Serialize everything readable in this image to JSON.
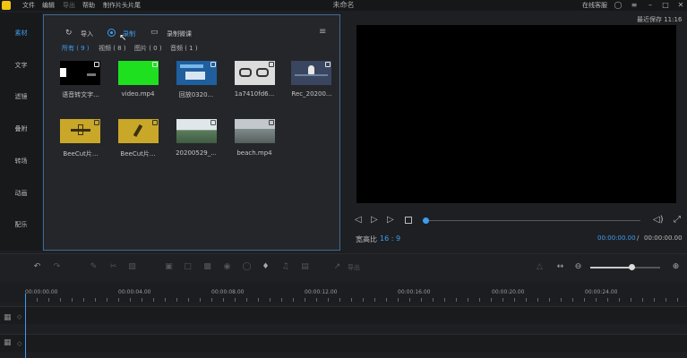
{
  "app": {
    "title": "未命名",
    "menus": [
      "文件",
      "编辑",
      "导出",
      "帮助",
      "制作片头片尾"
    ],
    "help": "在线客服"
  },
  "sidebar": [
    "素材",
    "文字",
    "滤镜",
    "叠附",
    "转场",
    "动画",
    "配乐"
  ],
  "toolbar": {
    "import": "导入",
    "record": "录制",
    "record_voice": "录制微课"
  },
  "filters": [
    "所有 ( 9 )",
    "视频 ( 8 )",
    "图片 ( 0 )",
    "音频 ( 1 )"
  ],
  "media": [
    {
      "name": "语音转文字...",
      "kind": "black-bars"
    },
    {
      "name": "video.mp4",
      "kind": "green"
    },
    {
      "name": "回放0320...",
      "kind": "blue"
    },
    {
      "name": "1a7410fd6...",
      "kind": "glasses"
    },
    {
      "name": "Rec_20200...",
      "kind": "mic"
    },
    {
      "name": "BeeCut片...",
      "kind": "yellow1"
    },
    {
      "name": "BeeCut片...",
      "kind": "yellow2"
    },
    {
      "name": "20200529_...",
      "kind": "sky"
    },
    {
      "name": "beach.mp4",
      "kind": "beach"
    }
  ],
  "preview": {
    "autosave": "最近保存 11:16",
    "ratio_label": "宽高比",
    "ratio_value": "16 : 9",
    "time_current": "00:00:00.00",
    "time_sep": "/",
    "time_total": "00:00:00.00"
  },
  "timeline": {
    "export": "导出",
    "ruler": [
      "00:00:00.00",
      "00:00:04.00",
      "00:00:08.00",
      "00:00:12.00",
      "00:00:16.00",
      "00:00:20.00",
      "00:00:24.00"
    ]
  },
  "colors": {
    "accent": "#3e9df2",
    "border": "#3b6c95"
  }
}
